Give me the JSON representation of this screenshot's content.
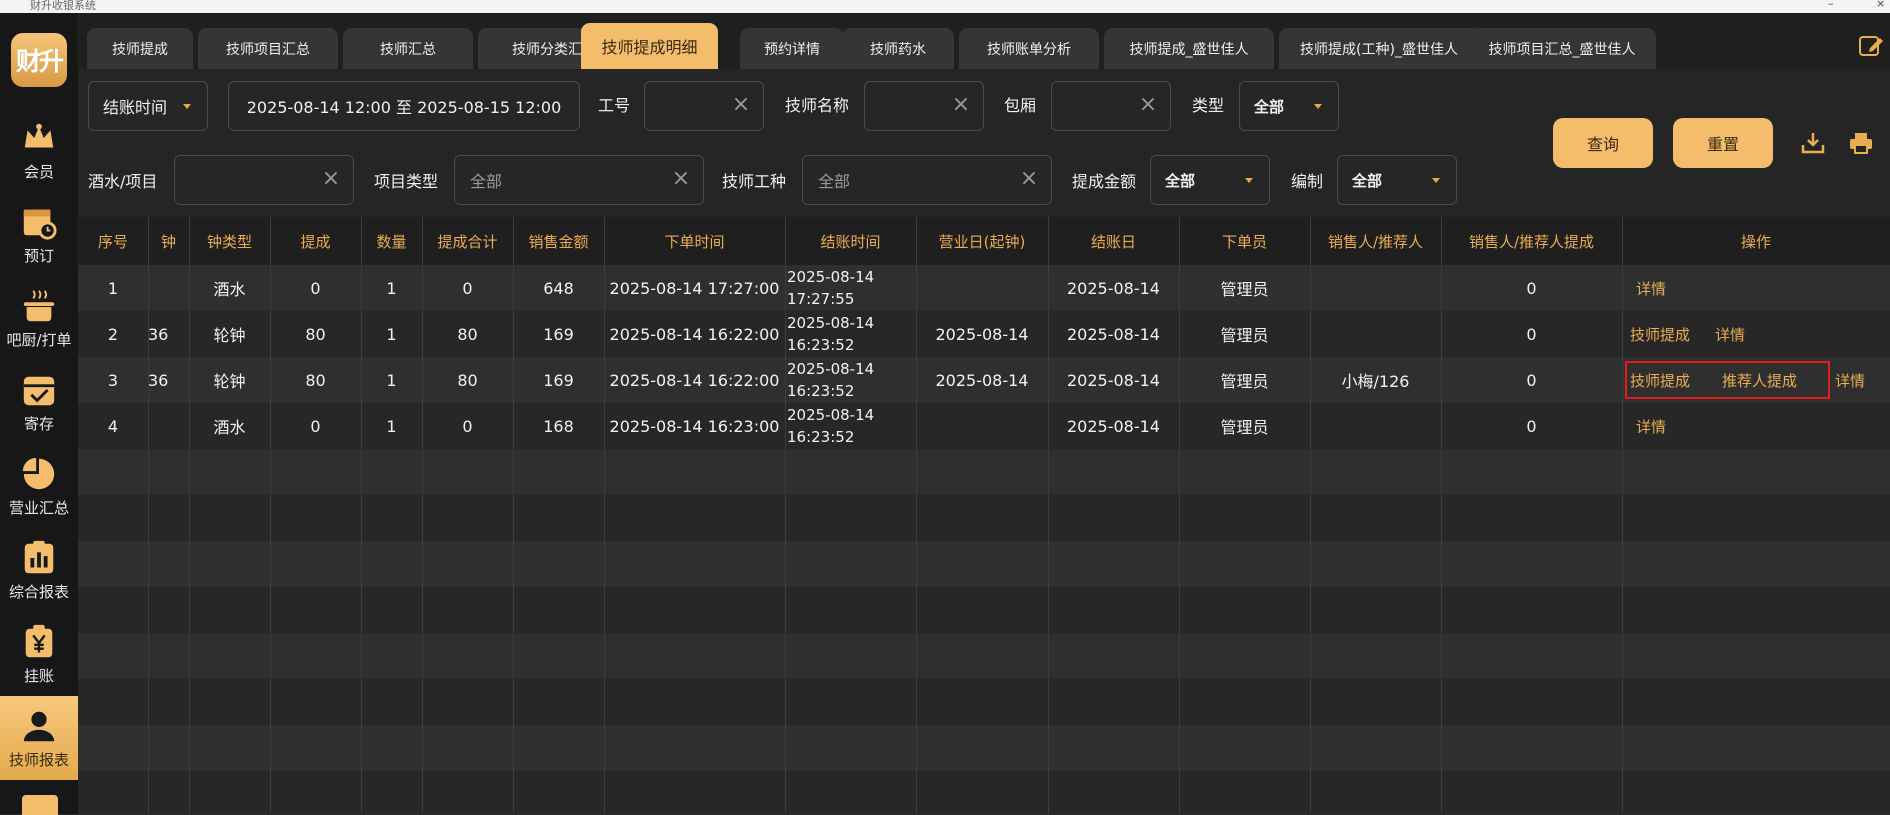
{
  "window": {
    "title": "财升收银系统"
  },
  "sidebar": {
    "logo": "财升",
    "items": [
      {
        "label": "会员",
        "icon": "crown-icon"
      },
      {
        "label": "预订",
        "icon": "calendar-clock-icon"
      },
      {
        "label": "吧厨/打单",
        "icon": "cooking-pot-icon"
      },
      {
        "label": "寄存",
        "icon": "storage-box-icon"
      },
      {
        "label": "营业汇总",
        "icon": "pie-chart-icon"
      },
      {
        "label": "综合报表",
        "icon": "report-chart-icon"
      },
      {
        "label": "挂账",
        "icon": "yen-clipboard-icon"
      },
      {
        "label": "技师报表",
        "icon": "user-icon",
        "active": true
      }
    ]
  },
  "tabs": [
    "技师提成",
    "技师项目汇总",
    "技师汇总",
    "技师分类汇总",
    "技师提成明细",
    "预约详情",
    "技师药水",
    "技师账单分析",
    "技师提成_盛世佳人",
    "技师提成(工种)_盛世佳人",
    "技师项目汇总_盛世佳人"
  ],
  "active_tab": "技师提成明细",
  "filters": {
    "time_type": "结账时间",
    "date_range": "2025-08-14 12:00  至  2025-08-15 12:00",
    "job_no_label": "工号",
    "tech_name_label": "技师名称",
    "room_label": "包厢",
    "type_label": "类型",
    "type_value": "全部",
    "drink_item_label": "酒水/项目",
    "item_type_label": "项目类型",
    "item_type_value": "全部",
    "tech_job_label": "技师工种",
    "tech_job_value": "全部",
    "commission_amount_label": "提成金额",
    "commission_amount_value": "全部",
    "staffing_label": "编制",
    "staffing_value": "全部",
    "query_label": "查询",
    "reset_label": "重置"
  },
  "table": {
    "headers": [
      "序号",
      "钟",
      "钟类型",
      "提成",
      "数量",
      "提成合计",
      "销售金额",
      "下单时间",
      "结账时间",
      "营业日(起钟)",
      "结账日",
      "下单员",
      "销售人/推荐人",
      "销售人/推荐人提成",
      "操作"
    ],
    "rows": [
      {
        "no": "1",
        "clock": "",
        "clock_type": "酒水",
        "commission": "0",
        "qty": "1",
        "commission_total": "0",
        "sales": "648",
        "order_time": "2025-08-14 17:27:00",
        "checkout_time": "2025-08-14 17:27:55",
        "biz_day": "",
        "checkout_day": "2025-08-14",
        "operator": "管理员",
        "seller": "",
        "seller_commission": "0",
        "ops": [
          "详情"
        ]
      },
      {
        "no": "2",
        "clock": "36",
        "clock_type": "轮钟",
        "commission": "80",
        "qty": "1",
        "commission_total": "80",
        "sales": "169",
        "order_time": "2025-08-14 16:22:00",
        "checkout_time": "2025-08-14 16:23:52",
        "biz_day": "2025-08-14",
        "checkout_day": "2025-08-14",
        "operator": "管理员",
        "seller": "",
        "seller_commission": "0",
        "ops": [
          "技师提成",
          "详情"
        ]
      },
      {
        "no": "3",
        "clock": "36",
        "clock_type": "轮钟",
        "commission": "80",
        "qty": "1",
        "commission_total": "80",
        "sales": "169",
        "order_time": "2025-08-14 16:22:00",
        "checkout_time": "2025-08-14 16:23:52",
        "biz_day": "2025-08-14",
        "checkout_day": "2025-08-14",
        "operator": "管理员",
        "seller": "小梅/126",
        "seller_commission": "0",
        "ops": [
          "技师提成",
          "推荐人提成",
          "详情"
        ]
      },
      {
        "no": "4",
        "clock": "",
        "clock_type": "酒水",
        "commission": "0",
        "qty": "1",
        "commission_total": "0",
        "sales": "168",
        "order_time": "2025-08-14 16:23:00",
        "checkout_time": "2025-08-14 16:23:52",
        "biz_day": "",
        "checkout_day": "2025-08-14",
        "operator": "管理员",
        "seller": "",
        "seller_commission": "0",
        "ops": [
          "详情"
        ]
      }
    ]
  },
  "colors": {
    "accent": "#f3bd6c",
    "header_text": "#e9ad52",
    "highlight": "#e0201b",
    "sidebar_bg": "#171717"
  }
}
